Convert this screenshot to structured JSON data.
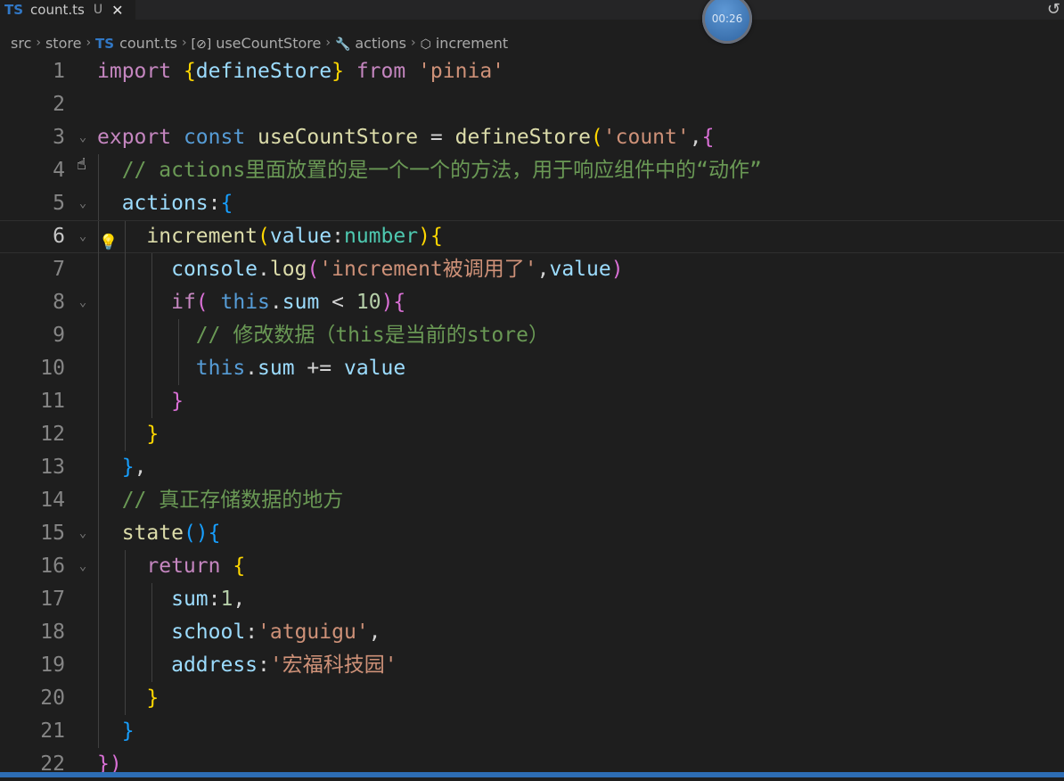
{
  "tab": {
    "lang_badge": "TS",
    "file_name": "count.ts",
    "status": "U",
    "close_glyph": "✕"
  },
  "timer": {
    "text": "00:26"
  },
  "breadcrumb": [
    {
      "kind": "text",
      "label": "src"
    },
    {
      "kind": "text",
      "label": "store"
    },
    {
      "kind": "ts",
      "badge": "TS",
      "label": "count.ts"
    },
    {
      "kind": "symbol",
      "icon": "variable-icon",
      "glyph": "[⊘]",
      "label": "useCountStore"
    },
    {
      "kind": "symbol",
      "icon": "wrench-icon",
      "glyph": "🔧",
      "label": "actions"
    },
    {
      "kind": "symbol",
      "icon": "cube-icon",
      "glyph": "⬡",
      "label": "increment"
    }
  ],
  "editor": {
    "current_line": 6,
    "lines": [
      {
        "n": "1",
        "fold": false,
        "guides": [],
        "tokens": [
          {
            "t": "import ",
            "c": "kw-c"
          },
          {
            "t": "{",
            "c": "p1"
          },
          {
            "t": "defineStore",
            "c": "var"
          },
          {
            "t": "}",
            "c": "p1"
          },
          {
            "t": " from ",
            "c": "kw-c"
          },
          {
            "t": "'pinia'",
            "c": "str"
          }
        ]
      },
      {
        "n": "2",
        "fold": false,
        "guides": [],
        "tokens": []
      },
      {
        "n": "3",
        "fold": true,
        "guides": [],
        "tokens": [
          {
            "t": "export ",
            "c": "kw-c"
          },
          {
            "t": "const ",
            "c": "kw-b"
          },
          {
            "t": "useCountStore",
            "c": "fn"
          },
          {
            "t": " = ",
            "c": "pl"
          },
          {
            "t": "defineStore",
            "c": "fn"
          },
          {
            "t": "(",
            "c": "p1"
          },
          {
            "t": "'count'",
            "c": "str"
          },
          {
            "t": ",",
            "c": "pl"
          },
          {
            "t": "{",
            "c": "p2"
          }
        ]
      },
      {
        "n": "4",
        "fold": false,
        "guides": [
          1
        ],
        "tokens": [
          {
            "t": "  ",
            "c": "pl"
          },
          {
            "t": "// actions里面放置的是一个一个的方法，用于响应组件中的“动作”",
            "c": "cmt"
          }
        ]
      },
      {
        "n": "5",
        "fold": true,
        "guides": [
          1
        ],
        "tokens": [
          {
            "t": "  ",
            "c": "pl"
          },
          {
            "t": "actions",
            "c": "var"
          },
          {
            "t": ":",
            "c": "pl"
          },
          {
            "t": "{",
            "c": "p3"
          }
        ]
      },
      {
        "n": "6",
        "fold": true,
        "guides": [
          1,
          2
        ],
        "tokens": [
          {
            "t": "    ",
            "c": "pl"
          },
          {
            "t": "increment",
            "c": "fn"
          },
          {
            "t": "(",
            "c": "p1"
          },
          {
            "t": "value",
            "c": "var"
          },
          {
            "t": ":",
            "c": "pl"
          },
          {
            "t": "number",
            "c": "typ"
          },
          {
            "t": ")",
            "c": "p1"
          },
          {
            "t": "{",
            "c": "p1"
          }
        ]
      },
      {
        "n": "7",
        "fold": false,
        "guides": [
          1,
          2,
          3
        ],
        "tokens": [
          {
            "t": "      ",
            "c": "pl"
          },
          {
            "t": "console",
            "c": "var"
          },
          {
            "t": ".",
            "c": "pl"
          },
          {
            "t": "log",
            "c": "fn"
          },
          {
            "t": "(",
            "c": "p2"
          },
          {
            "t": "'increment被调用了'",
            "c": "str"
          },
          {
            "t": ",",
            "c": "pl"
          },
          {
            "t": "value",
            "c": "var"
          },
          {
            "t": ")",
            "c": "p2"
          }
        ]
      },
      {
        "n": "8",
        "fold": true,
        "guides": [
          1,
          2,
          3
        ],
        "tokens": [
          {
            "t": "      ",
            "c": "pl"
          },
          {
            "t": "if",
            "c": "kw-c"
          },
          {
            "t": "(",
            "c": "p2"
          },
          {
            "t": " ",
            "c": "pl"
          },
          {
            "t": "this",
            "c": "kw-b"
          },
          {
            "t": ".",
            "c": "pl"
          },
          {
            "t": "sum",
            "c": "var"
          },
          {
            "t": " < ",
            "c": "pl"
          },
          {
            "t": "10",
            "c": "num"
          },
          {
            "t": ")",
            "c": "p2"
          },
          {
            "t": "{",
            "c": "p2"
          }
        ]
      },
      {
        "n": "9",
        "fold": false,
        "guides": [
          1,
          2,
          3,
          4
        ],
        "tokens": [
          {
            "t": "        ",
            "c": "pl"
          },
          {
            "t": "// 修改数据（this是当前的store）",
            "c": "cmt"
          }
        ]
      },
      {
        "n": "10",
        "fold": false,
        "guides": [
          1,
          2,
          3,
          4
        ],
        "tokens": [
          {
            "t": "        ",
            "c": "pl"
          },
          {
            "t": "this",
            "c": "kw-b"
          },
          {
            "t": ".",
            "c": "pl"
          },
          {
            "t": "sum",
            "c": "var"
          },
          {
            "t": " += ",
            "c": "pl"
          },
          {
            "t": "value",
            "c": "var"
          }
        ]
      },
      {
        "n": "11",
        "fold": false,
        "guides": [
          1,
          2,
          3
        ],
        "tokens": [
          {
            "t": "      ",
            "c": "pl"
          },
          {
            "t": "}",
            "c": "p2"
          }
        ]
      },
      {
        "n": "12",
        "fold": false,
        "guides": [
          1,
          2
        ],
        "tokens": [
          {
            "t": "    ",
            "c": "pl"
          },
          {
            "t": "}",
            "c": "p1"
          }
        ]
      },
      {
        "n": "13",
        "fold": false,
        "guides": [
          1
        ],
        "tokens": [
          {
            "t": "  ",
            "c": "pl"
          },
          {
            "t": "}",
            "c": "p3"
          },
          {
            "t": ",",
            "c": "pl"
          }
        ]
      },
      {
        "n": "14",
        "fold": false,
        "guides": [
          1
        ],
        "tokens": [
          {
            "t": "  ",
            "c": "pl"
          },
          {
            "t": "// 真正存储数据的地方",
            "c": "cmt"
          }
        ]
      },
      {
        "n": "15",
        "fold": true,
        "guides": [
          1
        ],
        "tokens": [
          {
            "t": "  ",
            "c": "pl"
          },
          {
            "t": "state",
            "c": "fn"
          },
          {
            "t": "()",
            "c": "p3"
          },
          {
            "t": "{",
            "c": "p3"
          }
        ]
      },
      {
        "n": "16",
        "fold": true,
        "guides": [
          1,
          2
        ],
        "tokens": [
          {
            "t": "    ",
            "c": "pl"
          },
          {
            "t": "return ",
            "c": "kw-c"
          },
          {
            "t": "{",
            "c": "p1"
          }
        ]
      },
      {
        "n": "17",
        "fold": false,
        "guides": [
          1,
          2,
          3
        ],
        "tokens": [
          {
            "t": "      ",
            "c": "pl"
          },
          {
            "t": "sum",
            "c": "var"
          },
          {
            "t": ":",
            "c": "pl"
          },
          {
            "t": "1",
            "c": "num"
          },
          {
            "t": ",",
            "c": "pl"
          }
        ]
      },
      {
        "n": "18",
        "fold": false,
        "guides": [
          1,
          2,
          3
        ],
        "tokens": [
          {
            "t": "      ",
            "c": "pl"
          },
          {
            "t": "school",
            "c": "var"
          },
          {
            "t": ":",
            "c": "pl"
          },
          {
            "t": "'atguigu'",
            "c": "str"
          },
          {
            "t": ",",
            "c": "pl"
          }
        ]
      },
      {
        "n": "19",
        "fold": false,
        "guides": [
          1,
          2,
          3
        ],
        "tokens": [
          {
            "t": "      ",
            "c": "pl"
          },
          {
            "t": "address",
            "c": "var"
          },
          {
            "t": ":",
            "c": "pl"
          },
          {
            "t": "'宏福科技园'",
            "c": "str"
          }
        ]
      },
      {
        "n": "20",
        "fold": false,
        "guides": [
          1,
          2
        ],
        "tokens": [
          {
            "t": "    ",
            "c": "pl"
          },
          {
            "t": "}",
            "c": "p1"
          }
        ]
      },
      {
        "n": "21",
        "fold": false,
        "guides": [
          1
        ],
        "tokens": [
          {
            "t": "  ",
            "c": "pl"
          },
          {
            "t": "}",
            "c": "p3"
          }
        ]
      },
      {
        "n": "22",
        "fold": false,
        "guides": [],
        "tokens": [
          {
            "t": "})",
            "c": "p2"
          }
        ]
      }
    ]
  }
}
